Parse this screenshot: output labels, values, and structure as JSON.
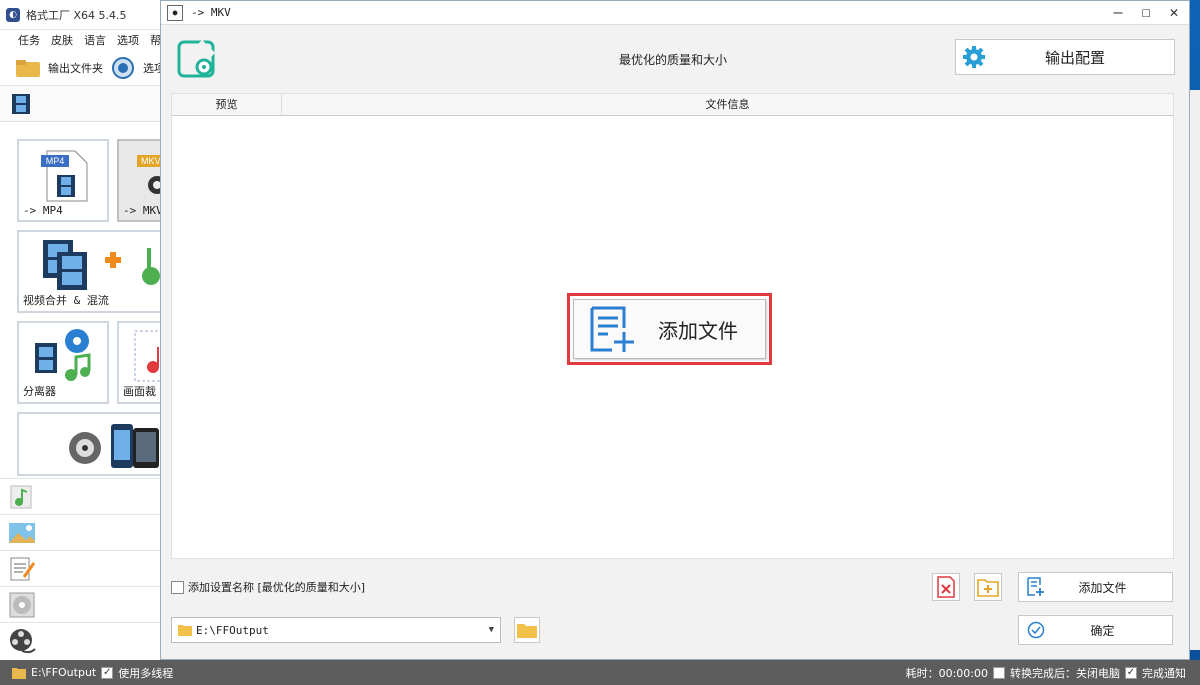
{
  "app": {
    "title": "格式工厂 X64 5.4.5",
    "menu": [
      "任务",
      "皮肤",
      "语言",
      "选项",
      "帮"
    ],
    "toolbar": {
      "output_folder": "输出文件夹",
      "options": "选项"
    },
    "tiles": [
      {
        "label": "-> MP4",
        "badge": "MP4"
      },
      {
        "label": "-> MKV",
        "badge": "MKV"
      },
      {
        "label": "视频合并 & 混流"
      },
      {
        "label": "分离器"
      },
      {
        "label": "画面裁"
      }
    ]
  },
  "dialog": {
    "title": "-> MKV",
    "preset_title": "最优化的质量和大小",
    "output_config_label": "输出配置",
    "columns": {
      "preview": "预览",
      "file_info": "文件信息"
    },
    "add_file_big_label": "添加文件",
    "preset_checkbox_label": "添加设置名称 [最优化的质量和大小]",
    "add_file_label": "添加文件",
    "confirm_label": "确定",
    "output_path": "E:\\FFOutput"
  },
  "status": {
    "output_path": "E:\\FFOutput",
    "multithread": "使用多线程",
    "elapsed": "耗时：00:00:00",
    "after_done": "转换完成后：关闭电脑",
    "notify": "完成通知"
  },
  "colors": {
    "accent": "#2a9fd6",
    "highlight": "#e0393e",
    "statusbar": "#5d5d5d"
  }
}
